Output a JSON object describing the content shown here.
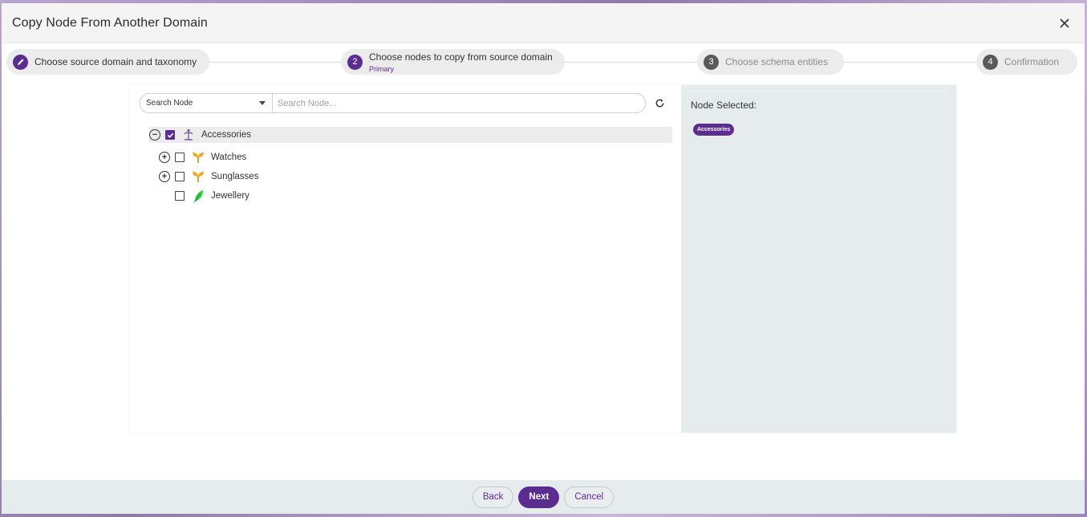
{
  "dialog": {
    "title": "Copy Node From Another Domain",
    "close_label": "✕"
  },
  "steps": [
    {
      "number": "",
      "label": "Choose source domain and taxonomy",
      "sub": "",
      "state": "done"
    },
    {
      "number": "2",
      "label": "Choose nodes to copy from source domain",
      "sub": "Primary",
      "state": "active"
    },
    {
      "number": "3",
      "label": "Choose schema entities",
      "sub": "",
      "state": "inactive"
    },
    {
      "number": "4",
      "label": "Confirmation",
      "sub": "",
      "state": "inactive"
    }
  ],
  "search": {
    "select_value": "Search Node",
    "input_placeholder": "Search Node...",
    "input_value": ""
  },
  "tree": {
    "root": {
      "label": "Accessories",
      "checked": true,
      "expanded": true,
      "icon": "taxonomy-root-icon"
    },
    "children": [
      {
        "label": "Watches",
        "checked": false,
        "expandable": true,
        "icon": "sprout-icon"
      },
      {
        "label": "Sunglasses",
        "checked": false,
        "expandable": true,
        "icon": "sprout-icon"
      },
      {
        "label": "Jewellery",
        "checked": false,
        "expandable": false,
        "icon": "leaf-icon"
      }
    ]
  },
  "selection_panel": {
    "title": "Node Selected:",
    "chips": [
      "Accessories"
    ]
  },
  "footer": {
    "back_label": "Back",
    "next_label": "Next",
    "cancel_label": "Cancel"
  },
  "colors": {
    "accent": "#5c2d91",
    "sprout": "#f5a623",
    "leaf": "#2ecc40"
  }
}
